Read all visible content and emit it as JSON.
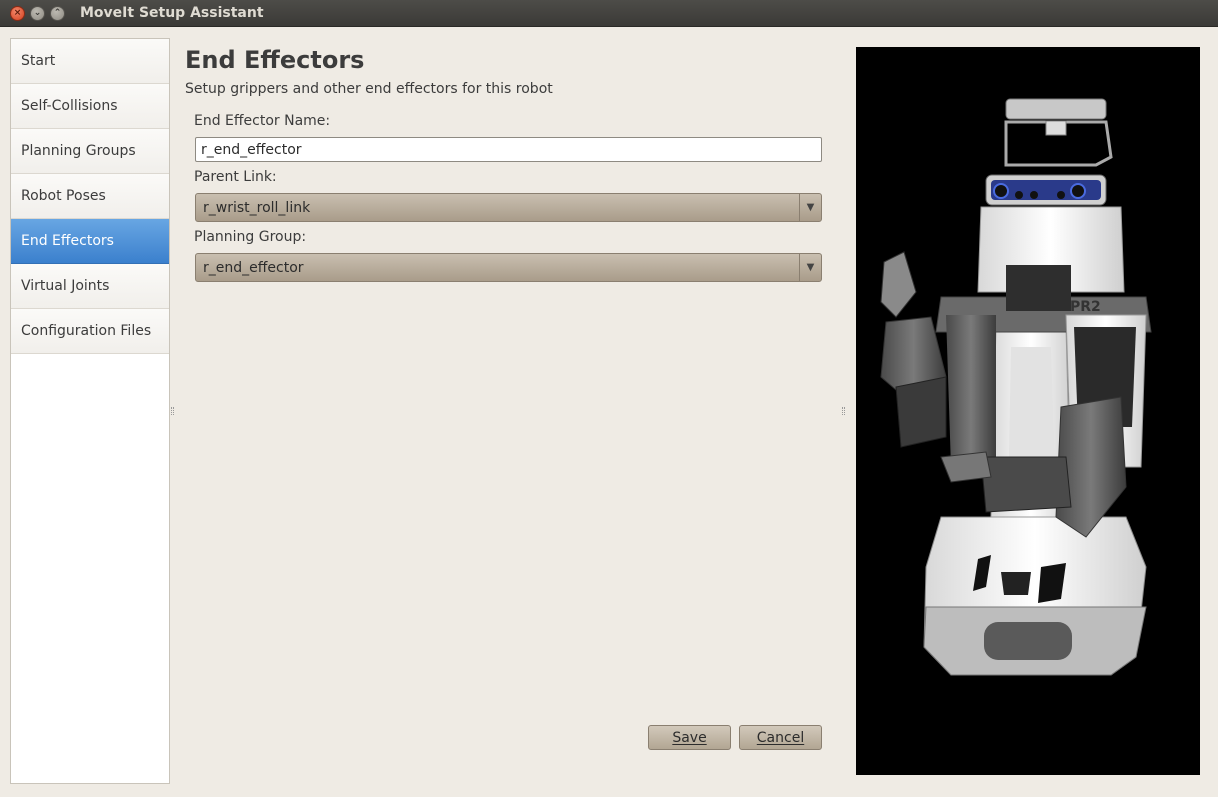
{
  "window": {
    "title": "MoveIt Setup Assistant"
  },
  "sidebar": {
    "items": [
      {
        "label": "Start",
        "active": false
      },
      {
        "label": "Self-Collisions",
        "active": false
      },
      {
        "label": "Planning Groups",
        "active": false
      },
      {
        "label": "Robot Poses",
        "active": false
      },
      {
        "label": "End Effectors",
        "active": true
      },
      {
        "label": "Virtual Joints",
        "active": false
      },
      {
        "label": "Configuration Files",
        "active": false
      }
    ]
  },
  "main": {
    "title": "End Effectors",
    "subtitle": "Setup grippers and other end effectors for this robot",
    "form": {
      "name_label": "End Effector Name:",
      "name_value": "r_end_effector",
      "parent_link_label": "Parent Link:",
      "parent_link_value": "r_wrist_roll_link",
      "planning_group_label": "Planning Group:",
      "planning_group_value": "r_end_effector"
    },
    "buttons": {
      "save_label": "Save",
      "cancel_label": "Cancel"
    }
  },
  "viewport": {
    "robot_label": "PR2"
  },
  "colors": {
    "accent": "#3b80cd",
    "titlebar": "#3b3a37",
    "background": "#efebe4"
  }
}
